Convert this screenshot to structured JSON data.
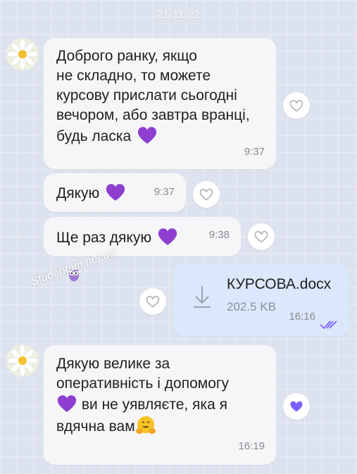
{
  "date_separator": "21.11.22",
  "messages": [
    {
      "text_lines": [
        "Доброго ранку, якщо",
        "не складно, то можете",
        "курсову прислати сьогодні",
        "вечором, або завтра вранці,",
        "будь ласка"
      ],
      "emoji": "purple-heart",
      "time": "9:37"
    },
    {
      "text": "Дякую",
      "emoji": "purple-heart",
      "time": "9:37"
    },
    {
      "text": "Ще раз дякую",
      "emoji": "purple-heart",
      "time": "9:38"
    },
    {
      "file_name": "КУРСОВА.docx",
      "file_size": "202.5 KB",
      "time": "16:16",
      "status": "read"
    },
    {
      "text_lines": [
        "Дякую велике за",
        "оперативність і допомогу",
        "ви не уявляєте, яка я",
        "вдячна вам"
      ],
      "emojis": [
        "purple-heart",
        "hugging-face"
      ],
      "time": "16:19",
      "reaction": "filled-heart"
    }
  ],
  "watermark": "Studentam.net.ua",
  "colors": {
    "accent": "#7b61ff",
    "incoming_bubble": "#f6f6f8",
    "outgoing_bubble": "#dbe7fa",
    "emoji_heart": "#8e3fcf"
  }
}
